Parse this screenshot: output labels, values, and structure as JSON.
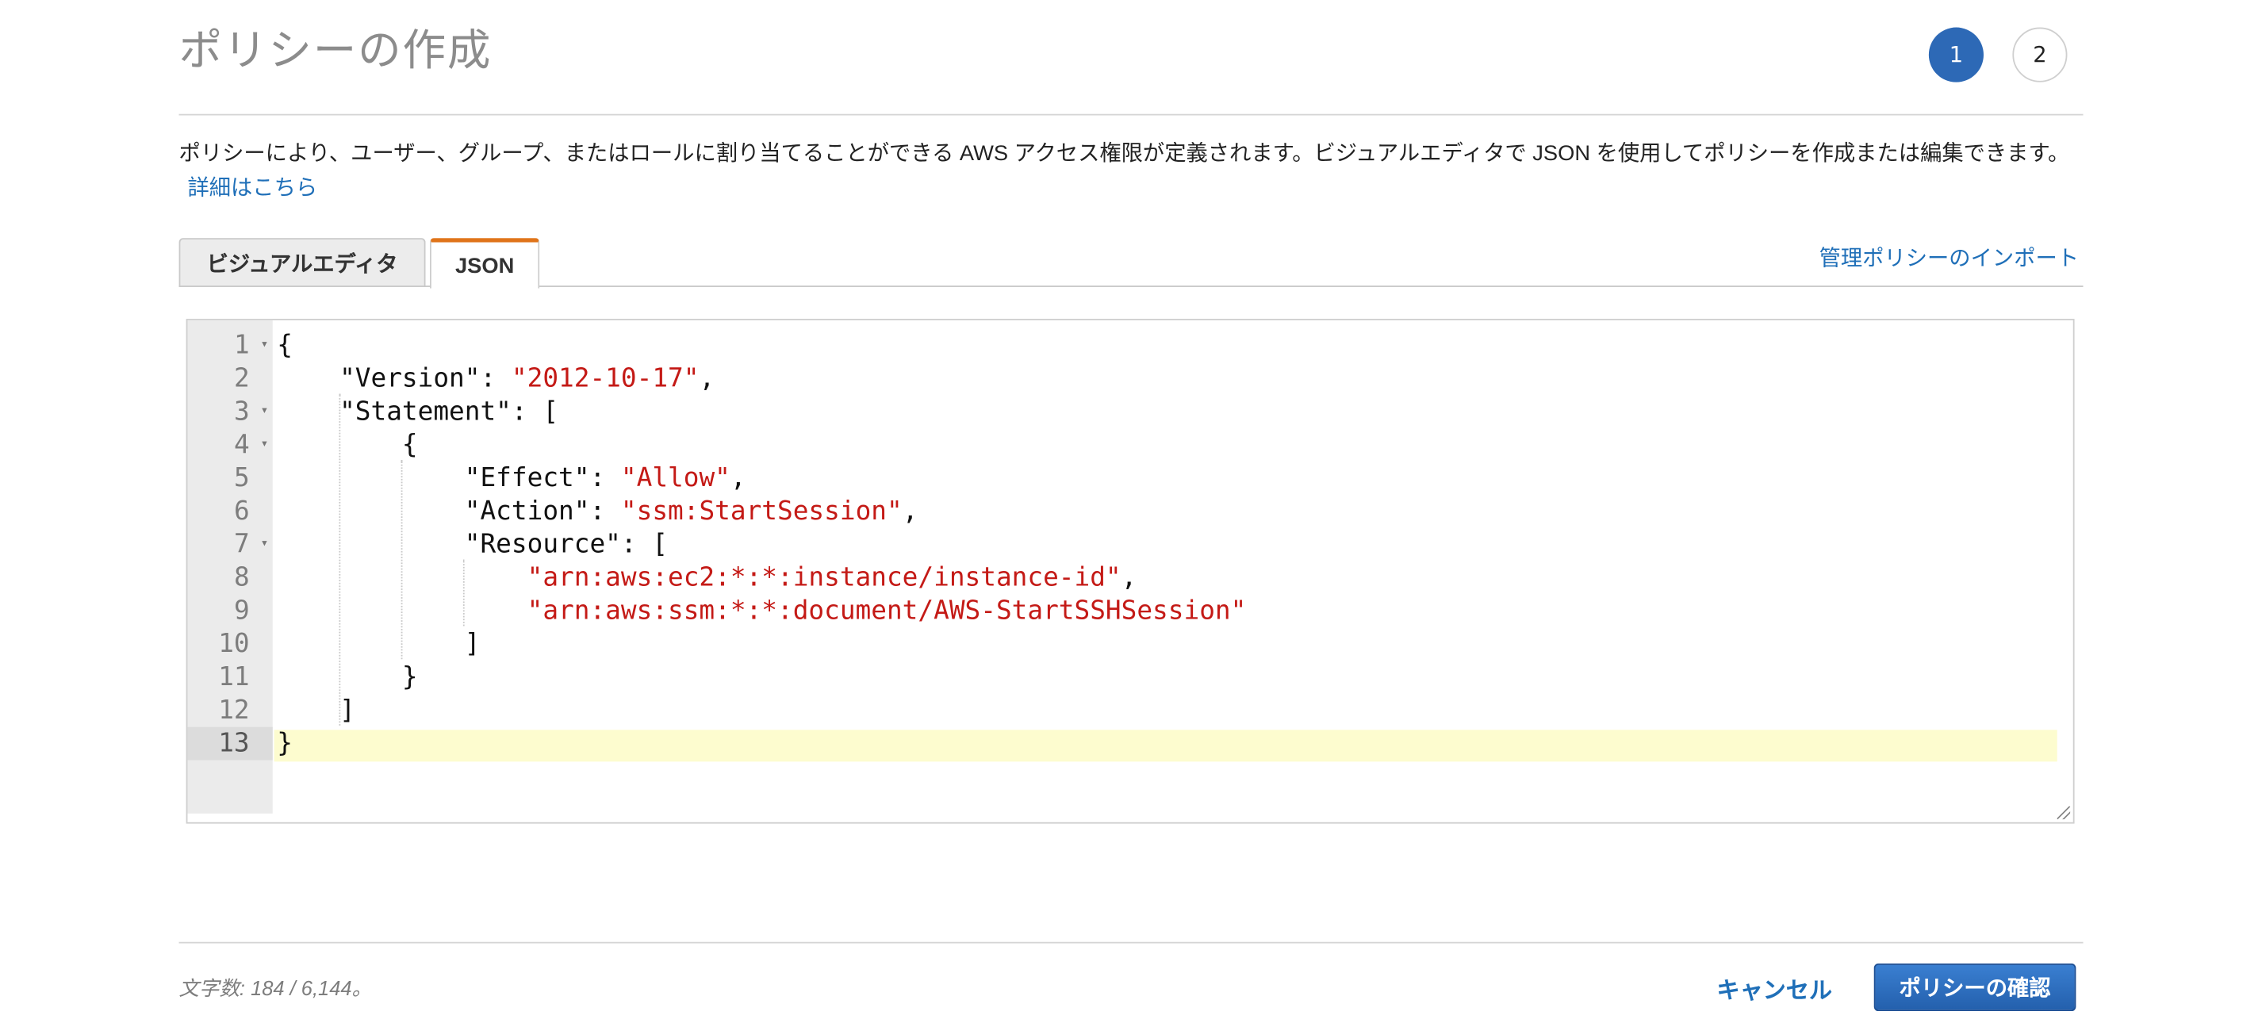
{
  "header": {
    "title": "ポリシーの作成",
    "steps": [
      "1",
      "2"
    ]
  },
  "description": {
    "text": "ポリシーにより、ユーザー、グループ、またはロールに割り当てることができる AWS アクセス権限が定義されます。ビジュアルエディタで JSON を使用してポリシーを作成または編集できます。",
    "link": "詳細はこちら"
  },
  "tabs": [
    {
      "label": "ビジュアルエディタ"
    },
    {
      "label": "JSON"
    }
  ],
  "import_link": "管理ポリシーのインポート",
  "editor": {
    "line_numbers": [
      "1",
      "2",
      "3",
      "4",
      "5",
      "6",
      "7",
      "8",
      "9",
      "10",
      "11",
      "12",
      "13"
    ],
    "lines": [
      {
        "tokens": [
          {
            "t": "{"
          }
        ]
      },
      {
        "tokens": [
          {
            "t": "    \"Version\": "
          },
          {
            "t": "\"2012-10-17\"",
            "s": true
          },
          {
            "t": ","
          }
        ]
      },
      {
        "tokens": [
          {
            "t": "    \"Statement\": ["
          }
        ]
      },
      {
        "tokens": [
          {
            "t": "        {"
          }
        ]
      },
      {
        "tokens": [
          {
            "t": "            \"Effect\": "
          },
          {
            "t": "\"Allow\"",
            "s": true
          },
          {
            "t": ","
          }
        ]
      },
      {
        "tokens": [
          {
            "t": "            \"Action\": "
          },
          {
            "t": "\"ssm:StartSession\"",
            "s": true
          },
          {
            "t": ","
          }
        ]
      },
      {
        "tokens": [
          {
            "t": "            \"Resource\": ["
          }
        ]
      },
      {
        "tokens": [
          {
            "t": "                "
          },
          {
            "t": "\"arn:aws:ec2:*:*:instance/instance-id\"",
            "s": true
          },
          {
            "t": ","
          }
        ]
      },
      {
        "tokens": [
          {
            "t": "                "
          },
          {
            "t": "\"arn:aws:ssm:*:*:document/AWS-StartSSHSession\"",
            "s": true
          }
        ]
      },
      {
        "tokens": [
          {
            "t": "            ]"
          }
        ]
      },
      {
        "tokens": [
          {
            "t": "        }"
          }
        ]
      },
      {
        "tokens": [
          {
            "t": "    ]"
          }
        ]
      },
      {
        "tokens": [
          {
            "t": "}"
          }
        ]
      }
    ],
    "string_color": "#c41a16"
  },
  "footer": {
    "char_count": "文字数: 184 / 6,144。",
    "cancel": "キャンセル",
    "confirm": "ポリシーの確認"
  },
  "colors": {
    "accent": "#2d69b6",
    "tab_highlight": "#e0741a",
    "link": "#1f6fb8"
  }
}
